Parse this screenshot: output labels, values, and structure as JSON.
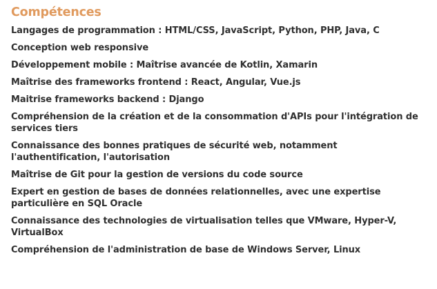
{
  "section": {
    "title": "Compétences",
    "title_color": "#e09a5e",
    "text_color": "#2f2f2f",
    "items": [
      "Langages de programmation : HTML/CSS, JavaScript, Python, PHP, Java, C",
      "Conception web responsive",
      "Développement mobile : Maîtrise avancée de Kotlin, Xamarin",
      "Maîtrise des frameworks frontend : React, Angular, Vue.js",
      "Maitrise frameworks backend : Django",
      "Compréhension de la création et de la consommation d'APIs pour l'intégration de services tiers",
      "Connaissance des bonnes pratiques de sécurité web, notamment l'authentification, l'autorisation",
      "Maîtrise de Git pour la gestion de versions du code source",
      "Expert en gestion de bases de données relationnelles, avec une expertise particulière en SQL Oracle",
      "Connaissance des technologies de virtualisation telles que VMware, Hyper-V, VirtualBox",
      "Compréhension de l'administration de base de Windows Server, Linux"
    ]
  }
}
